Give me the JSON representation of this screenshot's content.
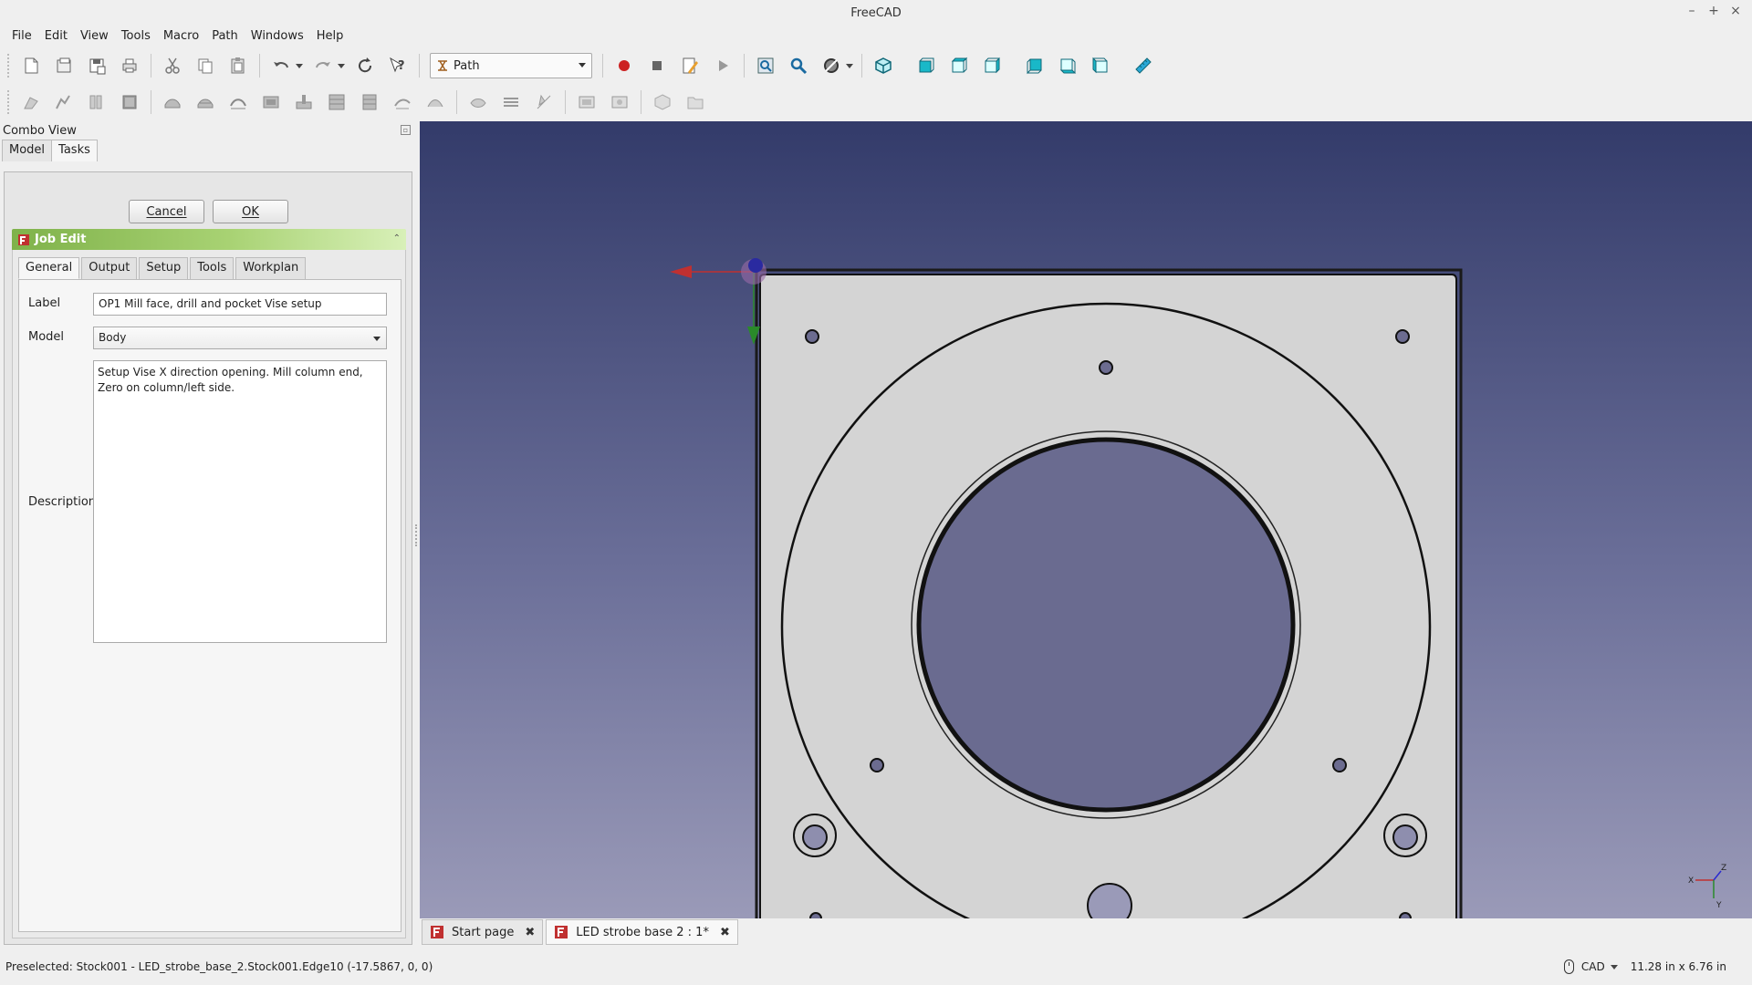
{
  "window": {
    "title": "FreeCAD",
    "controls": [
      "–",
      "+",
      "×"
    ]
  },
  "menu": [
    "File",
    "Edit",
    "View",
    "Tools",
    "Macro",
    "Path",
    "Windows",
    "Help"
  ],
  "toolbar": {
    "workbench": "Path"
  },
  "combo": {
    "title": "Combo View",
    "tabs": [
      "Model",
      "Tasks"
    ],
    "active_tab": "Tasks",
    "cancel_label": "Cancel",
    "ok_label": "OK",
    "job_title": "Job Edit",
    "job_tabs": [
      "General",
      "Output",
      "Setup",
      "Tools",
      "Workplan"
    ],
    "active_job_tab": "General",
    "fields": {
      "label_caption": "Label",
      "label_value": "OP1 Mill face, drill and pocket Vise setup",
      "model_caption": "Model",
      "model_value": "Body",
      "description_caption": "Description",
      "description_value": "Setup Vise X direction opening. Mill column end, Zero on column/left side."
    }
  },
  "doc_tabs": [
    {
      "label": "Start page",
      "active": false
    },
    {
      "label": "LED strobe base 2 : 1*",
      "active": true
    }
  ],
  "status": {
    "message": "Preselected: Stock001 - LED_strobe_base_2.Stock001.Edge10 (-17.5867, 0, 0)",
    "nav_style": "CAD",
    "dimensions": "11.28 in x 6.76 in"
  },
  "axis_labels": {
    "x": "X",
    "y": "Y",
    "z": "Z"
  },
  "colors": {
    "accent_green": "#8cc05a",
    "record_red": "#cc2222",
    "view_cube_cyan": "#19b8c8"
  }
}
